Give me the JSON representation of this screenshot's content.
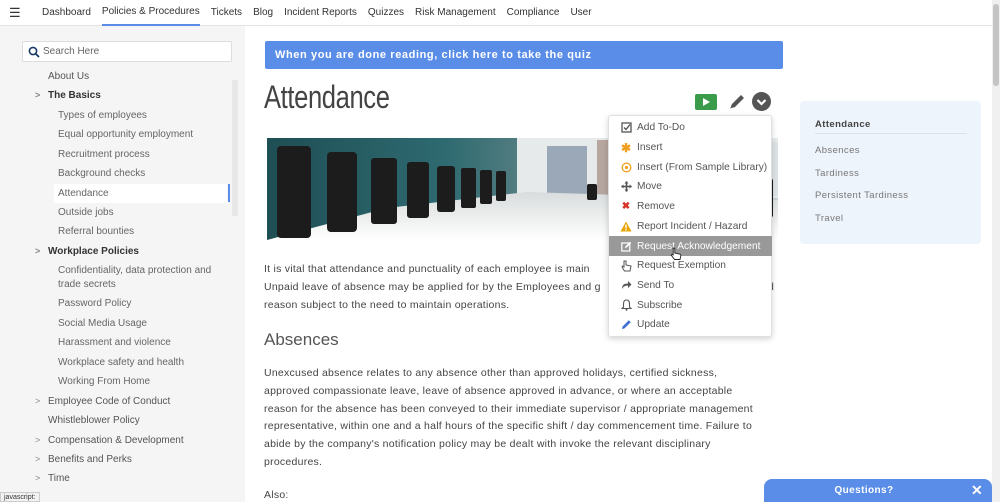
{
  "topnav": {
    "items": [
      "Dashboard",
      "Policies & Procedures",
      "Tickets",
      "Blog",
      "Incident Reports",
      "Quizzes",
      "Risk Management",
      "Compliance",
      "User"
    ],
    "active_index": 1
  },
  "sidebar": {
    "search_placeholder": "Search Here",
    "items": [
      {
        "label": "About Us",
        "level": "top",
        "chevron": false
      },
      {
        "label": "The Basics",
        "level": "top",
        "chevron": true,
        "bold": true
      },
      {
        "label": "Types of employees",
        "level": "sub"
      },
      {
        "label": "Equal opportunity employment",
        "level": "sub"
      },
      {
        "label": "Recruitment process",
        "level": "sub"
      },
      {
        "label": "Background checks",
        "level": "sub"
      },
      {
        "label": "Attendance",
        "level": "sub",
        "selected": true
      },
      {
        "label": "Outside jobs",
        "level": "sub"
      },
      {
        "label": "Referral bounties",
        "level": "sub"
      },
      {
        "label": "Workplace Policies",
        "level": "top",
        "chevron": true,
        "bold": true
      },
      {
        "label": "Confidentiality, data protection and trade secrets",
        "level": "sub"
      },
      {
        "label": "Password Policy",
        "level": "sub"
      },
      {
        "label": "Social Media Usage",
        "level": "sub"
      },
      {
        "label": "Harassment and violence",
        "level": "sub"
      },
      {
        "label": "Workplace safety and health",
        "level": "sub"
      },
      {
        "label": "Working From Home",
        "level": "sub"
      },
      {
        "label": "Employee Code of Conduct",
        "level": "top",
        "chevron": true
      },
      {
        "label": "Whistleblower Policy",
        "level": "top",
        "chevron": false
      },
      {
        "label": "Compensation & Development",
        "level": "top",
        "chevron": true
      },
      {
        "label": "Benefits and Perks",
        "level": "top",
        "chevron": true
      },
      {
        "label": "Time",
        "level": "top",
        "chevron": true
      }
    ]
  },
  "main": {
    "quiz_banner": "When you are done reading, click here to take the quiz",
    "title": "Attendance",
    "intro_lines": [
      "It is vital that attendance and punctuality of each employee is main",
      "Unpaid leave of absence may be applied for by the Employees and g",
      "reason subject to the need to maintain operations."
    ],
    "intro_tail": [
      "",
      "d",
      ""
    ],
    "section_heading": "Absences",
    "absences_lines": [
      "Unexcused absence relates to any absence other than approved holidays, certified sickness,",
      "approved compassionate leave, leave of absence approved in advance, or where an acceptable",
      "reason for the absence has been conveyed to their immediate supervisor / appropriate management",
      "representative, within one and a half hours of the specific shift / day commencement time. Failure to",
      "abide by the company's notification policy may be dealt with invoke the relevant disciplinary",
      "procedures."
    ],
    "also": "Also:"
  },
  "menu": {
    "items": [
      {
        "label": "Add To-Do",
        "icon": "checkbox-icon",
        "color": "#555555"
      },
      {
        "label": "Insert",
        "icon": "asterisk-icon",
        "color": "#f0a020"
      },
      {
        "label": "Insert (From Sample Library)",
        "icon": "sample-library-icon",
        "color": "#f0a020"
      },
      {
        "label": "Move",
        "icon": "move-icon",
        "color": "#555555"
      },
      {
        "label": "Remove",
        "icon": "remove-icon",
        "color": "#d9342b"
      },
      {
        "label": "Report Incident / Hazard",
        "icon": "warning-icon",
        "color": "#e8a400"
      },
      {
        "label": "Request Acknowledgement",
        "icon": "edit-square-icon",
        "color": "#ffffff",
        "hover": true
      },
      {
        "label": "Request Exemption",
        "icon": "hand-pointer-icon",
        "color": "#555555"
      },
      {
        "label": "Send To",
        "icon": "share-arrow-icon",
        "color": "#555555"
      },
      {
        "label": "Subscribe",
        "icon": "bell-icon",
        "color": "#555555"
      },
      {
        "label": "Update",
        "icon": "pencil-icon",
        "color": "#3c6fcf"
      }
    ]
  },
  "right_toc": {
    "title": "Attendance",
    "items": [
      "Absences",
      "Tardiness",
      "Persistent Tardiness",
      "Travel"
    ]
  },
  "questions_widget": {
    "label": "Questions?",
    "close": "✕"
  },
  "status_tip": "javascript:",
  "colors": {
    "accent": "#5a8de8",
    "video_green": "#3a9b4a"
  }
}
